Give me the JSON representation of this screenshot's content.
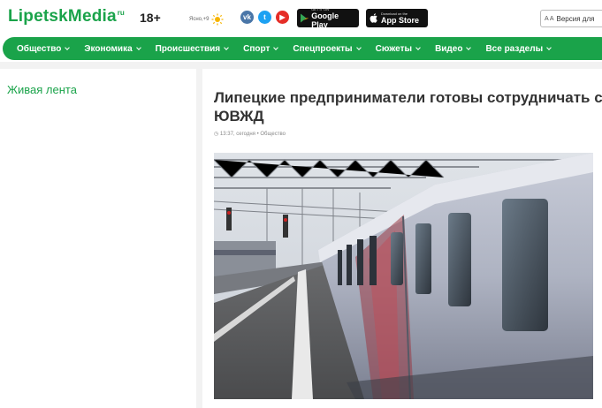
{
  "header": {
    "logo_text": "LipetskMedia",
    "logo_sup": "ru",
    "age_rating": "18+",
    "weather_text": "Ясно,+9",
    "weather_icon": "sun-icon",
    "social": [
      {
        "name": "vk",
        "glyph": "vk",
        "color": "#4a76a8"
      },
      {
        "name": "twitter",
        "glyph": "t",
        "color": "#1da1f2"
      },
      {
        "name": "youtube",
        "glyph": "▶",
        "color": "#e52d27"
      }
    ],
    "google_play": {
      "small": "GET IT ON",
      "big": "Google Play"
    },
    "app_store": {
      "small": "Download on the",
      "big": "App Store"
    },
    "version_label": "Версия для",
    "version_icon_text": "A A"
  },
  "nav": {
    "items": [
      {
        "label": "Общество"
      },
      {
        "label": "Экономика"
      },
      {
        "label": "Происшествия"
      },
      {
        "label": "Спорт"
      },
      {
        "label": "Спецпроекты"
      },
      {
        "label": "Сюжеты"
      },
      {
        "label": "Видео"
      },
      {
        "label": "Все разделы"
      }
    ]
  },
  "sidebar": {
    "title": "Живая лента"
  },
  "article": {
    "title": "Липецкие предприниматели готовы сотрудничать с ЮВЖД",
    "time": "13:37, сегодня",
    "separator": "•",
    "category": "Общество"
  },
  "colors": {
    "brand_green": "#1aa34a",
    "page_bg": "#f2f2f2"
  }
}
